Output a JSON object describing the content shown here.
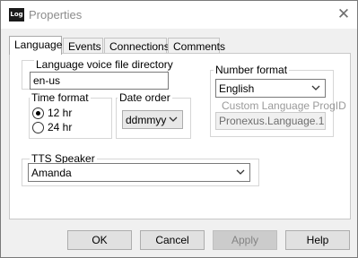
{
  "window": {
    "icon_text": "Log",
    "title": "Properties",
    "close_glyph": "✕"
  },
  "tabs": [
    {
      "label": "Language",
      "active": true
    },
    {
      "label": "Events",
      "active": false
    },
    {
      "label": "Connections",
      "active": false
    },
    {
      "label": "Comments",
      "active": false
    }
  ],
  "language": {
    "voice_dir_label": "Language voice file directory",
    "voice_dir_value": "en-us",
    "time_format": {
      "label": "Time format",
      "options": [
        "12 hr",
        "24 hr"
      ],
      "selected": "12 hr"
    },
    "date_order": {
      "label": "Date order",
      "value": "ddmmyy"
    },
    "number_format": {
      "label": "Number format",
      "value": "English"
    },
    "custom_progid": {
      "label": "Custom Language ProgID",
      "value": "Pronexus.Language.1"
    },
    "tts_speaker": {
      "label": "TTS Speaker",
      "value": "Amanda"
    }
  },
  "buttons": {
    "ok": "OK",
    "cancel": "Cancel",
    "apply": "Apply",
    "help": "Help"
  }
}
